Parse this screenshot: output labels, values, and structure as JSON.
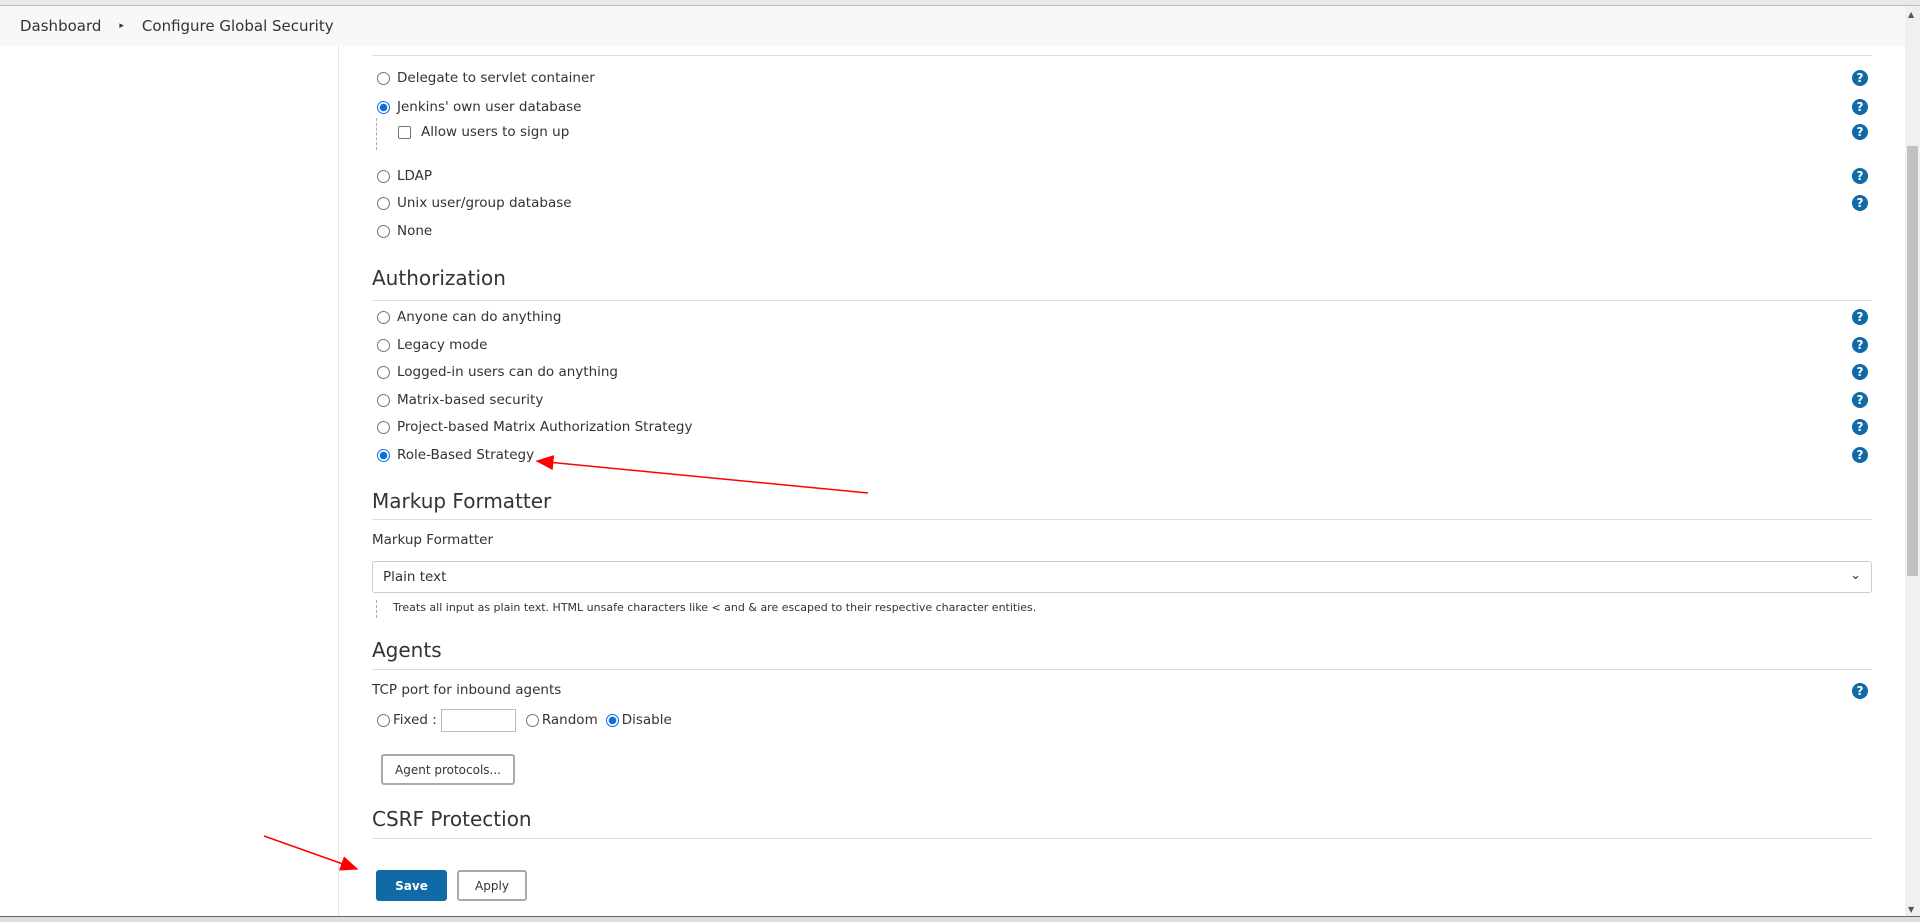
{
  "breadcrumb": {
    "home": "Dashboard",
    "separator": "▸",
    "current": "Configure Global Security"
  },
  "security_realm": {
    "options": [
      {
        "label": "Delegate to servlet container",
        "selected": false
      },
      {
        "label": "Jenkins' own user database",
        "selected": true
      },
      {
        "label": "LDAP",
        "selected": false
      },
      {
        "label": "Unix user/group database",
        "selected": false
      },
      {
        "label": "None",
        "selected": false
      }
    ],
    "allow_signup": {
      "label": "Allow users to sign up",
      "checked": false
    }
  },
  "authorization": {
    "title": "Authorization",
    "options": [
      {
        "label": "Anyone can do anything",
        "selected": false
      },
      {
        "label": "Legacy mode",
        "selected": false
      },
      {
        "label": "Logged-in users can do anything",
        "selected": false
      },
      {
        "label": "Matrix-based security",
        "selected": false
      },
      {
        "label": "Project-based Matrix Authorization Strategy",
        "selected": false
      },
      {
        "label": "Role-Based Strategy",
        "selected": true
      }
    ]
  },
  "markup": {
    "title": "Markup Formatter",
    "label": "Markup Formatter",
    "value": "Plain text",
    "description": "Treats all input as plain text. HTML unsafe characters like < and & are escaped to their respective character entities."
  },
  "agents": {
    "title": "Agents",
    "tcp_label": "TCP port for inbound agents",
    "fixed_label": "Fixed :",
    "fixed_value": "",
    "random_label": "Random",
    "disable_label": "Disable",
    "selected": "Disable",
    "protocols_button": "Agent protocols..."
  },
  "csrf": {
    "title": "CSRF Protection"
  },
  "actions": {
    "save": "Save",
    "apply": "Apply"
  },
  "help_icon": "?",
  "colors": {
    "primary": "#0f6aa5",
    "annotation": "#ff0000"
  }
}
